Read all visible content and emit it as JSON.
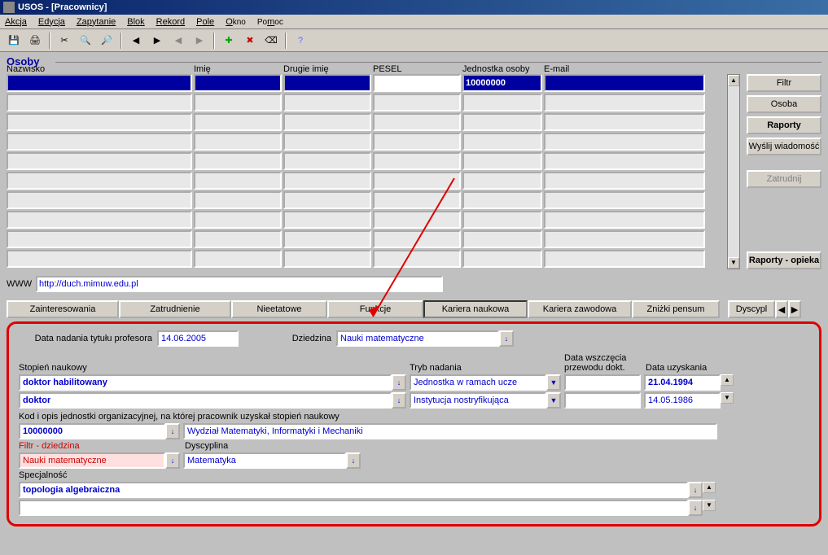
{
  "title": "USOS - [Pracownicy]",
  "menu": [
    "Akcja",
    "Edycja",
    "Zapytanie",
    "Blok",
    "Rekord",
    "Pole",
    "Okno",
    "Pomoc"
  ],
  "section": "Osoby",
  "headers": {
    "nazwisko": "Nazwisko",
    "imie": "Imię",
    "drugie": "Drugie imię",
    "pesel": "PESEL",
    "jednostka": "Jednostka osoby",
    "email": "E-mail"
  },
  "row0": {
    "nazwisko": "",
    "imie": "",
    "drugie": "",
    "pesel": "",
    "jednostka": "10000000",
    "email": ""
  },
  "sidebtns": {
    "filtr": "Filtr",
    "osoba": "Osoba",
    "raporty": "Raporty",
    "wyslij": "Wyślij wiadomość",
    "zatrudnij": "Zatrudnij",
    "raporty_opieka": "Raporty - opieka"
  },
  "www": {
    "label": "WWW",
    "value": "http://duch.mimuw.edu.pl"
  },
  "tabs": [
    "Zainteresowania",
    "Zatrudnienie",
    "Nieetatowe",
    "Funkcje",
    "Kariera naukowa",
    "Kariera zawodowa",
    "Zniżki pensum",
    "Dyscypl"
  ],
  "form": {
    "prof_label": "Data nadania tytułu profesora",
    "prof_date": "14.06.2005",
    "dziedzina_label": "Dziedzina",
    "dziedzina": "Nauki matematyczne",
    "stopien_label": "Stopień naukowy",
    "stopien1": "doktor habilitowany",
    "stopien2": "doktor",
    "tryb_label": "Tryb nadania",
    "tryb1": "Jednostka w ramach ucze",
    "tryb2": "Instytucja nostryfikująca",
    "wszcz_label": "Data wszczęcia przewodu dokt.",
    "uzysk_label": "Data uzyskania",
    "uzysk1": "21.04.1994",
    "uzysk2": "14.05.1986",
    "kod_label": "Kod i opis jednostki organizacyjnej, na której pracownik uzyskał stopień naukowy",
    "kod": "10000000",
    "kod_opis": "Wydział Matematyki, Informatyki i Mechaniki",
    "filtr_label": "Filtr - dziedzina",
    "filtr_val": "Nauki matematyczne",
    "dysc_label": "Dyscyplina",
    "dysc": "Matematyka",
    "spec_label": "Specjalność",
    "spec": "topologia algebraiczna"
  }
}
